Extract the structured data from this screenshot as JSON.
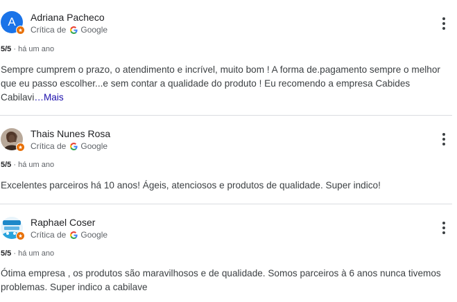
{
  "reviews": [
    {
      "name": "Adriana Pacheco",
      "avatar_letter": "A",
      "avatar_color": "#1a73e8",
      "source_label": "Crítica de",
      "source_name": "Google",
      "rating": "5/5",
      "time": "há um ano",
      "text": "Sempre cumprem o prazo, o atendimento e incrível, muito bom ! A forma de.pagamento sempre o melhor que eu passo escolher...e sem contar a qualidade do produto ! Eu recomendo a empresa Cabides Cabilavi",
      "more_label": "…Mais"
    },
    {
      "name": "Thais Nunes Rosa",
      "source_label": "Crítica de",
      "source_name": "Google",
      "rating": "5/5",
      "time": "há um ano",
      "text": "Excelentes parceiros há 10 anos! Ágeis, atenciosos e produtos de qualidade. Super indico!"
    },
    {
      "name": "Raphael Coser",
      "source_label": "Crítica de",
      "source_name": "Google",
      "rating": "5/5",
      "time": "há um ano",
      "text": "Ótima empresa , os produtos são maravilhosos e de qualidade. Somos parceiros à 6 anos nunca tivemos problemas. Super indico a cabilave"
    }
  ],
  "colors": {
    "badge": "#e8710a",
    "link": "#1a0dab",
    "divider": "#dadce0"
  },
  "icons": {
    "source": "google-g-icon",
    "menu": "more-vertical-icon",
    "badge": "local-guide-icon"
  }
}
